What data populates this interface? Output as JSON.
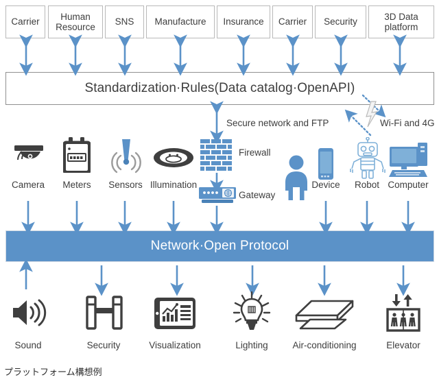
{
  "diagram": {
    "type": "layered-platform-architecture",
    "caption": "プラットフォーム構想例",
    "colors": {
      "accent_blue": "#5b92c8",
      "arrow_blue": "#5b92c8",
      "icon_dark": "#3f3f3f",
      "box_border": "#b8b8b8",
      "bar_text_light": "#ffffff"
    },
    "consumers": {
      "name": "top-consumer-layer",
      "items": [
        {
          "label": "Carrier"
        },
        {
          "label": "Human\nResource"
        },
        {
          "label": "SNS"
        },
        {
          "label": "Manufacture"
        },
        {
          "label": "Insurance"
        },
        {
          "label": "Carrier"
        },
        {
          "label": "Security"
        },
        {
          "label": "3D Data\nplatform"
        }
      ]
    },
    "standardization_bar": {
      "label": "Standardization·Rules(Data catalog·OpenAPI)"
    },
    "network_bar": {
      "label": "Network·Open Protocol"
    },
    "middle_layer": {
      "annotations": [
        {
          "label": "Secure network and FTP"
        },
        {
          "label": "Wi-Fi and  4G"
        }
      ],
      "nodes": [
        {
          "label": "Firewall",
          "icon": "brick-wall-icon"
        },
        {
          "label": "Gateway",
          "icon": "network-gateway-icon"
        }
      ],
      "devices": [
        {
          "label": "Camera",
          "icon": "dome-camera-icon"
        },
        {
          "label": "Meters",
          "icon": "utility-meter-icon"
        },
        {
          "label": "Sensors",
          "icon": "sensor-beam-icon"
        },
        {
          "label": "Illumination",
          "icon": "ceiling-light-icon"
        },
        {
          "label": "Device",
          "icon": "smartphone-icon"
        },
        {
          "label": "Robot",
          "icon": "robot-icon"
        },
        {
          "label": "Computer",
          "icon": "desktop-computer-icon"
        }
      ],
      "person": {
        "label": "",
        "icon": "person-icon"
      }
    },
    "building_services": {
      "name": "bottom-service-layer",
      "items": [
        {
          "label": "Sound",
          "icon": "speaker-sound-icon"
        },
        {
          "label": "Security",
          "icon": "turnstile-gate-icon"
        },
        {
          "label": "Visualization",
          "icon": "tablet-chart-icon"
        },
        {
          "label": "Lighting",
          "icon": "light-bulb-icon"
        },
        {
          "label": "Air-conditioning",
          "icon": "ceiling-ac-unit-icon"
        },
        {
          "label": "Elevator",
          "icon": "elevator-icon"
        }
      ]
    }
  }
}
